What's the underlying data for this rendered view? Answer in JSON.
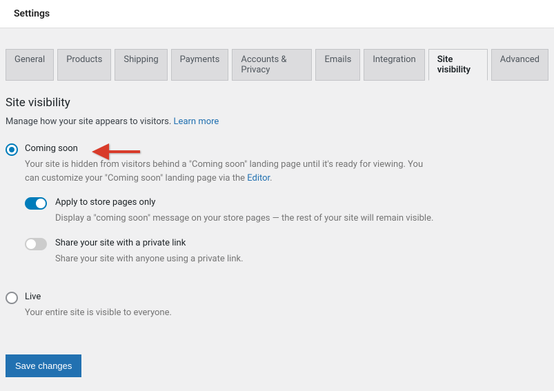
{
  "header": {
    "title": "Settings"
  },
  "tabs": [
    {
      "label": "General",
      "active": false
    },
    {
      "label": "Products",
      "active": false
    },
    {
      "label": "Shipping",
      "active": false
    },
    {
      "label": "Payments",
      "active": false
    },
    {
      "label": "Accounts & Privacy",
      "active": false
    },
    {
      "label": "Emails",
      "active": false
    },
    {
      "label": "Integration",
      "active": false
    },
    {
      "label": "Site visibility",
      "active": true
    },
    {
      "label": "Advanced",
      "active": false
    }
  ],
  "section": {
    "title": "Site visibility",
    "desc": "Manage how your site appears to visitors. ",
    "learn_more": "Learn more"
  },
  "options": {
    "coming_soon": {
      "label": "Coming soon",
      "desc_a": "Your site is hidden from visitors behind a \"Coming soon\" landing page until it's ready for viewing. You can customize your \"Coming soon\" landing page via the ",
      "editor_link": "Editor",
      "desc_b": ".",
      "selected": true,
      "store_pages": {
        "label": "Apply to store pages only",
        "desc": "Display a \"coming soon\" message on your store pages — the rest of your site will remain visible.",
        "enabled": true
      },
      "private_link": {
        "label": "Share your site with a private link",
        "desc": "Share your site with anyone using a private link.",
        "enabled": false
      }
    },
    "live": {
      "label": "Live",
      "desc": "Your entire site is visible to everyone.",
      "selected": false
    }
  },
  "actions": {
    "save": "Save changes"
  }
}
